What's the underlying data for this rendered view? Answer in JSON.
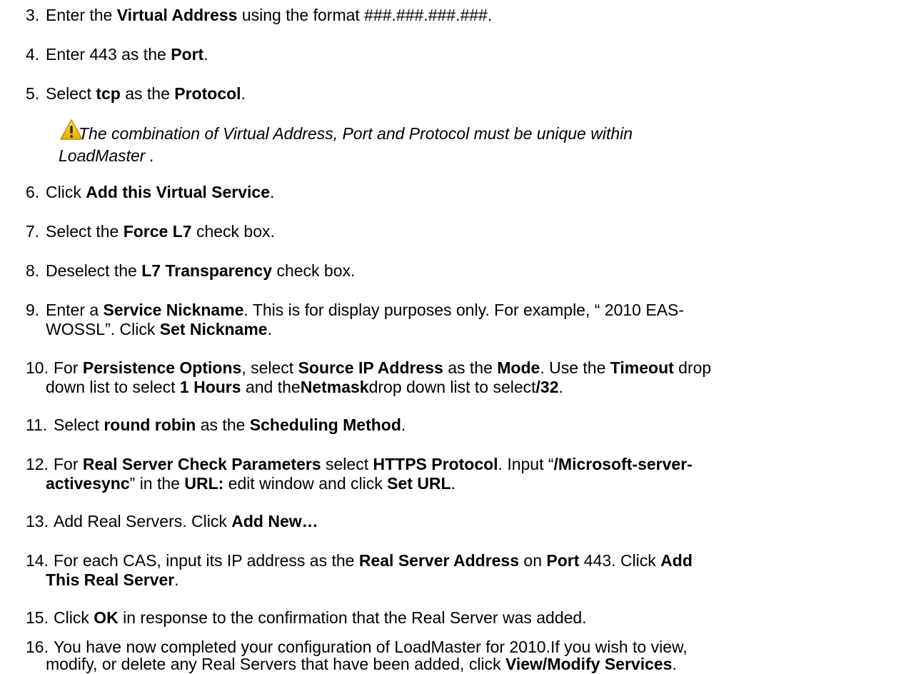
{
  "steps": [
    {
      "n": "3.",
      "parts": [
        "Enter the ",
        "Virtual Address",
        " using the format ###.###.###.###."
      ]
    },
    {
      "n": "4.",
      "parts": [
        "Enter 443 as the ",
        "Port",
        "."
      ]
    },
    {
      "n": "5.",
      "parts": [
        "Select ",
        "tcp",
        " as the ",
        "Protocol",
        "."
      ]
    },
    {
      "n": "6.",
      "parts": [
        "Click ",
        "Add this Virtual Service",
        "."
      ]
    },
    {
      "n": "7.",
      "parts": [
        "Select the ",
        "Force L7",
        " check box."
      ]
    },
    {
      "n": "8.",
      "parts": [
        "Deselect the ",
        "L7 Transparency",
        " check box."
      ]
    },
    {
      "n": "9.",
      "line1": [
        "Enter a ",
        "Service Nickname",
        ". This is for display purposes only. For example, “ 2010 EAS-"
      ],
      "line2": [
        "WOSSL”. Click ",
        "Set Nickname",
        "."
      ]
    },
    {
      "n": "10.",
      "line1": [
        "For ",
        "Persistence Options",
        ", select ",
        "Source IP Address",
        " as the ",
        "Mode",
        ". Use the ",
        "Timeout",
        " drop"
      ],
      "line2": [
        "down list to select ",
        "1 Hours",
        " and the",
        "Netmask",
        "drop down list to select",
        "/32",
        "."
      ]
    },
    {
      "n": "11.",
      "parts": [
        "Select ",
        "round robin",
        " as the ",
        "Scheduling Method",
        "."
      ]
    },
    {
      "n": "12.",
      "line1": [
        "For ",
        "Real Server Check Parameters",
        " select ",
        "HTTPS Protocol",
        ". Input “",
        "/Microsoft-server-"
      ],
      "line2": [
        "activesync",
        "” in the ",
        "URL:",
        " edit window and click ",
        "Set URL",
        "."
      ]
    },
    {
      "n": "13.",
      "parts": [
        "Add Real Servers. Click ",
        "Add New…"
      ]
    },
    {
      "n": "14.",
      "line1": [
        "For each CAS, input its IP address as the ",
        "Real Server Address",
        " on ",
        "Port",
        " 443. Click ",
        "Add"
      ],
      "line2": [
        "This Real Server",
        "."
      ]
    },
    {
      "n": "15.",
      "parts": [
        "Click ",
        "OK",
        " in response to the confirmation that the Real Server was added."
      ]
    },
    {
      "n": "16.",
      "line1": [
        "You have now completed your configuration of LoadMaster for  2010.If you wish to view,"
      ],
      "line2": [
        "modify, or delete any Real Servers that have been added, click ",
        "View/Modify Services",
        "."
      ]
    }
  ],
  "note": {
    "line1": "The combination of Virtual Address, Port and Protocol must be unique within",
    "line2": "LoadMaster  .",
    "icon": "warning-icon",
    "icon_color": "#f2c300"
  }
}
